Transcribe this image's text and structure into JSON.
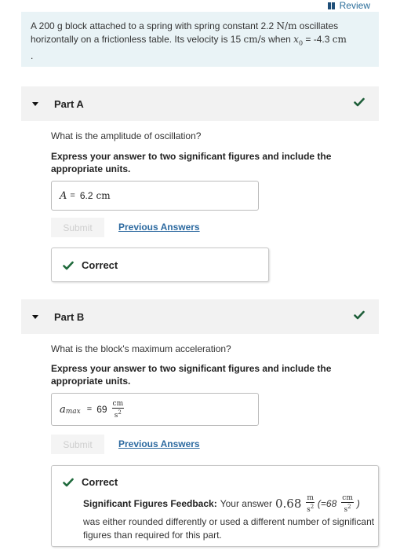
{
  "review": {
    "label": "Review"
  },
  "problem": {
    "t1": "A 200 g block attached to a spring with spring constant 2.2",
    "u1": "N/m",
    "t2": " oscillates",
    "t3": "horizontally on a frictionless table. Its velocity is 15",
    "u2": "cm/s",
    "t4": "when",
    "x0": "x",
    "x0sub": "0",
    "t5": "= -4.3",
    "u3": "cm",
    "t6": "."
  },
  "partA": {
    "title": "Part A",
    "question": "What is the amplitude of oscillation?",
    "instruction": "Express your answer to two significant figures and include the appropriate units.",
    "var": "A",
    "eq": "=",
    "value": "6.2",
    "unit": "cm",
    "submit": "Submit",
    "prev": "Previous Answers",
    "status": "Correct"
  },
  "partB": {
    "title": "Part B",
    "question": "What is the block's maximum acceleration?",
    "instruction": "Express your answer to two significant figures and include the appropriate units.",
    "var": "a",
    "var_sub": "max",
    "eq": "=",
    "value": "69",
    "unit_num": "cm",
    "unit_den": "s2",
    "submit": "Submit",
    "prev": "Previous Answers",
    "status": "Correct",
    "fb_bold": "Significant Figures Feedback:",
    "fb1": "Your answer",
    "fb_val": "0.68",
    "fb_u1_num": "m",
    "fb_u1_den": "s2",
    "fb_mid": "(=68",
    "fb_u2_num": "cm",
    "fb_u2_den": "s2",
    "fb_close": ")",
    "fb2": "was either rounded differently or used a different number of significant figures than required for this part."
  },
  "colors": {
    "check": "#1f5f3a",
    "link": "#2d6aa0",
    "problem_bg": "#e9f3f6"
  }
}
